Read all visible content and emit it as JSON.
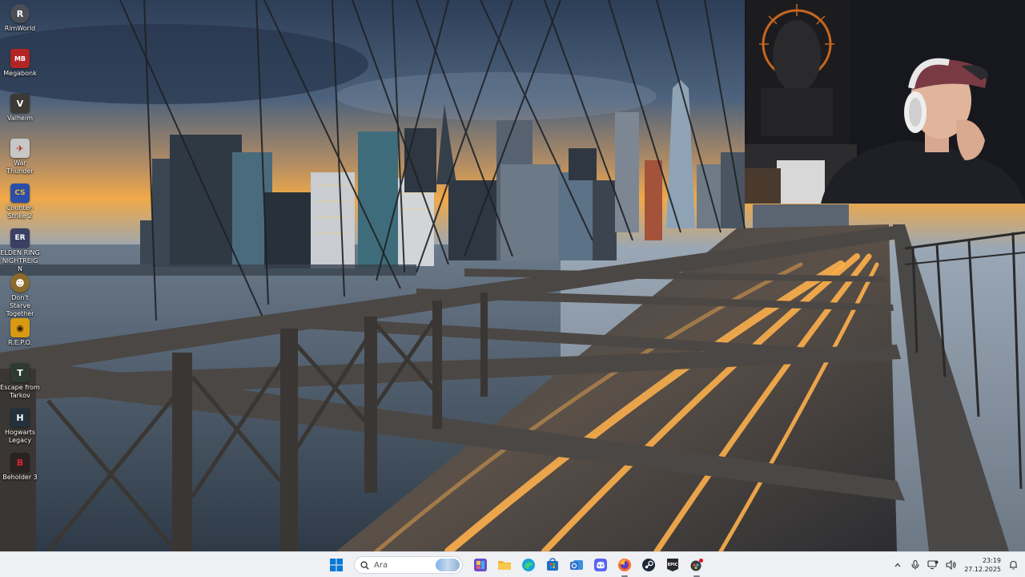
{
  "desktop": {
    "icons": [
      {
        "label": "RimWorld",
        "icon": "rimworld-icon",
        "color": "#4a4f57",
        "glyph": "R"
      },
      {
        "label": "Megabonk",
        "icon": "megabonk-icon",
        "color": "#b32525",
        "glyph": "MB"
      },
      {
        "label": "Valheim",
        "icon": "valheim-icon",
        "color": "#3c3a35",
        "glyph": "V"
      },
      {
        "label": "War Thunder",
        "icon": "war-thunder-icon",
        "color": "#c7c7c7",
        "glyph": "✈"
      },
      {
        "label": "Counter-Strike 2",
        "icon": "counter-strike-2-icon",
        "color": "#2b4fa8",
        "glyph": "CS"
      },
      {
        "label": "ELDEN RING NIGHTREIGN",
        "icon": "elden-ring-nightreign-icon",
        "color": "#3a3f63",
        "glyph": "ER"
      },
      {
        "label": "Don't Starve Together",
        "icon": "dont-starve-together-icon",
        "color": "#8b6a2b",
        "glyph": "☻"
      },
      {
        "label": "R.E.P.O.",
        "icon": "repo-icon",
        "color": "#d89a13",
        "glyph": "◉"
      },
      {
        "label": "Escape from Tarkov",
        "icon": "escape-from-tarkov-icon",
        "color": "#2f3a33",
        "glyph": "T"
      },
      {
        "label": "Hogwarts Legacy",
        "icon": "hogwarts-legacy-icon",
        "color": "#24303a",
        "glyph": "H"
      },
      {
        "label": "Beholder 3",
        "icon": "beholder-3-icon",
        "color": "#2a2222",
        "glyph": "B"
      }
    ]
  },
  "taskbar": {
    "search_placeholder": "Ara",
    "pinned": [
      {
        "name": "widgets-icon",
        "color": "#6a4cc9"
      },
      {
        "name": "file-explorer-icon",
        "color": "#f2b531"
      },
      {
        "name": "edge-icon",
        "color": "#1aa3d9"
      },
      {
        "name": "microsoft-store-icon",
        "color": "#1f6fc9"
      },
      {
        "name": "outlook-icon",
        "color": "#2c6ecb"
      },
      {
        "name": "discord-icon",
        "color": "#5865f2"
      },
      {
        "name": "firefox-icon",
        "color": "#ff6a2b"
      },
      {
        "name": "steam-icon",
        "color": "#1b2838"
      },
      {
        "name": "epic-games-icon",
        "color": "#2a2a2a"
      },
      {
        "name": "davinci-resolve-icon",
        "color": "#3a3a3a"
      }
    ],
    "clock": {
      "time": "23:19",
      "date": "27.12.2025"
    }
  }
}
